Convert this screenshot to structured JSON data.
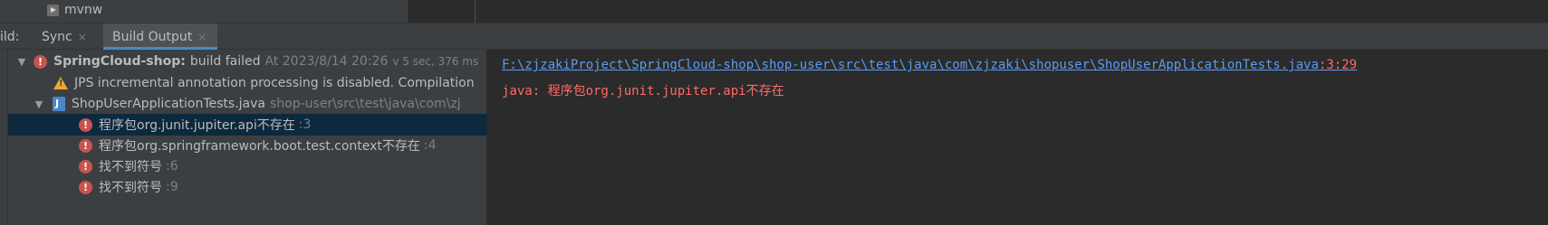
{
  "project": {
    "file_label": "mvnw",
    "file_icon": "script-file-icon"
  },
  "tabs": {
    "prefix_label": "ild:",
    "sync_label": "Sync",
    "build_output_label": "Build Output",
    "close_glyph": "×"
  },
  "tree": {
    "root": {
      "name": "SpringCloud-shop:",
      "status": "build failed",
      "time": "At 2023/8/14 20:26",
      "duration": "v 5 sec, 376 ms"
    },
    "warning": {
      "text": "JPS incremental annotation processing is disabled. Compilation"
    },
    "file": {
      "name": "ShopUserApplicationTests.java",
      "path": "shop-user\\src\\test\\java\\com\\zj"
    },
    "errors": [
      {
        "text": "程序包org.junit.jupiter.api不存在",
        "line": ":3"
      },
      {
        "text": "程序包org.springframework.boot.test.context不存在",
        "line": ":4"
      },
      {
        "text": "找不到符号",
        "line": ":6"
      },
      {
        "text": "找不到符号",
        "line": ":9"
      }
    ]
  },
  "console": {
    "file_link": "F:\\zjzakiProject\\SpringCloud-shop\\shop-user\\src\\test\\java\\com\\zjzaki\\shopuser\\ShopUserApplicationTests.java",
    "position": ":3:29",
    "message": "java: 程序包org.junit.jupiter.api不存在"
  },
  "colors": {
    "error": "#c75450",
    "warning": "#f0a732",
    "link": "#589df6",
    "error_text": "#ff6b68",
    "selection": "#0d293e",
    "tab_underline": "#4a88c7"
  }
}
